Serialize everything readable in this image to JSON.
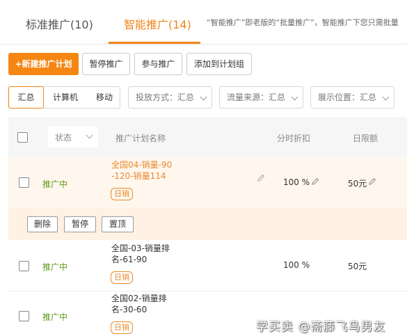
{
  "tabs": [
    {
      "label": "标准推广(10)"
    },
    {
      "label": "智能推广(14)"
    }
  ],
  "tab_note": "“智能推广”即老版的“批量推广”，智能推广下您只需批量",
  "toolbar": {
    "new_plan": "+新建推广计划",
    "pause": "暂停推广",
    "join": "参与推广",
    "add_group": "添加到计划组"
  },
  "filters": {
    "segments": [
      "汇总",
      "计算机",
      "移动"
    ],
    "delivery": "投放方式：汇总",
    "traffic": "流量来源：汇总",
    "position": "展示位置：汇总"
  },
  "table": {
    "status_header": "状态",
    "name_header": "推广计划名称",
    "discount_header": "分时折扣",
    "limit_header": "日限额",
    "rows": [
      {
        "status": "推广中",
        "name_line1": "全国04-销量-90",
        "name_line2": "-120-销量114",
        "badge": "日销",
        "discount": "100 %",
        "limit": "50元"
      },
      {
        "status": "推广中",
        "name_line1": "全国-03-销量排",
        "name_line2": "名-61-90",
        "badge": "日销",
        "discount": "100 %",
        "limit": "50元"
      },
      {
        "status": "推广中",
        "name_line1": "全国02-销量排",
        "name_line2": "名-30-60",
        "badge": "日销",
        "discount": "",
        "limit": ""
      }
    ]
  },
  "row_actions": {
    "delete": "删除",
    "pause": "暂停",
    "top": "置顶"
  },
  "watermark": "学买卖 @斋藤飞鸟男友",
  "colors": {
    "accent": "#f08519",
    "status_green": "#5e9a1a",
    "highlight_row": "#fff6ee"
  }
}
